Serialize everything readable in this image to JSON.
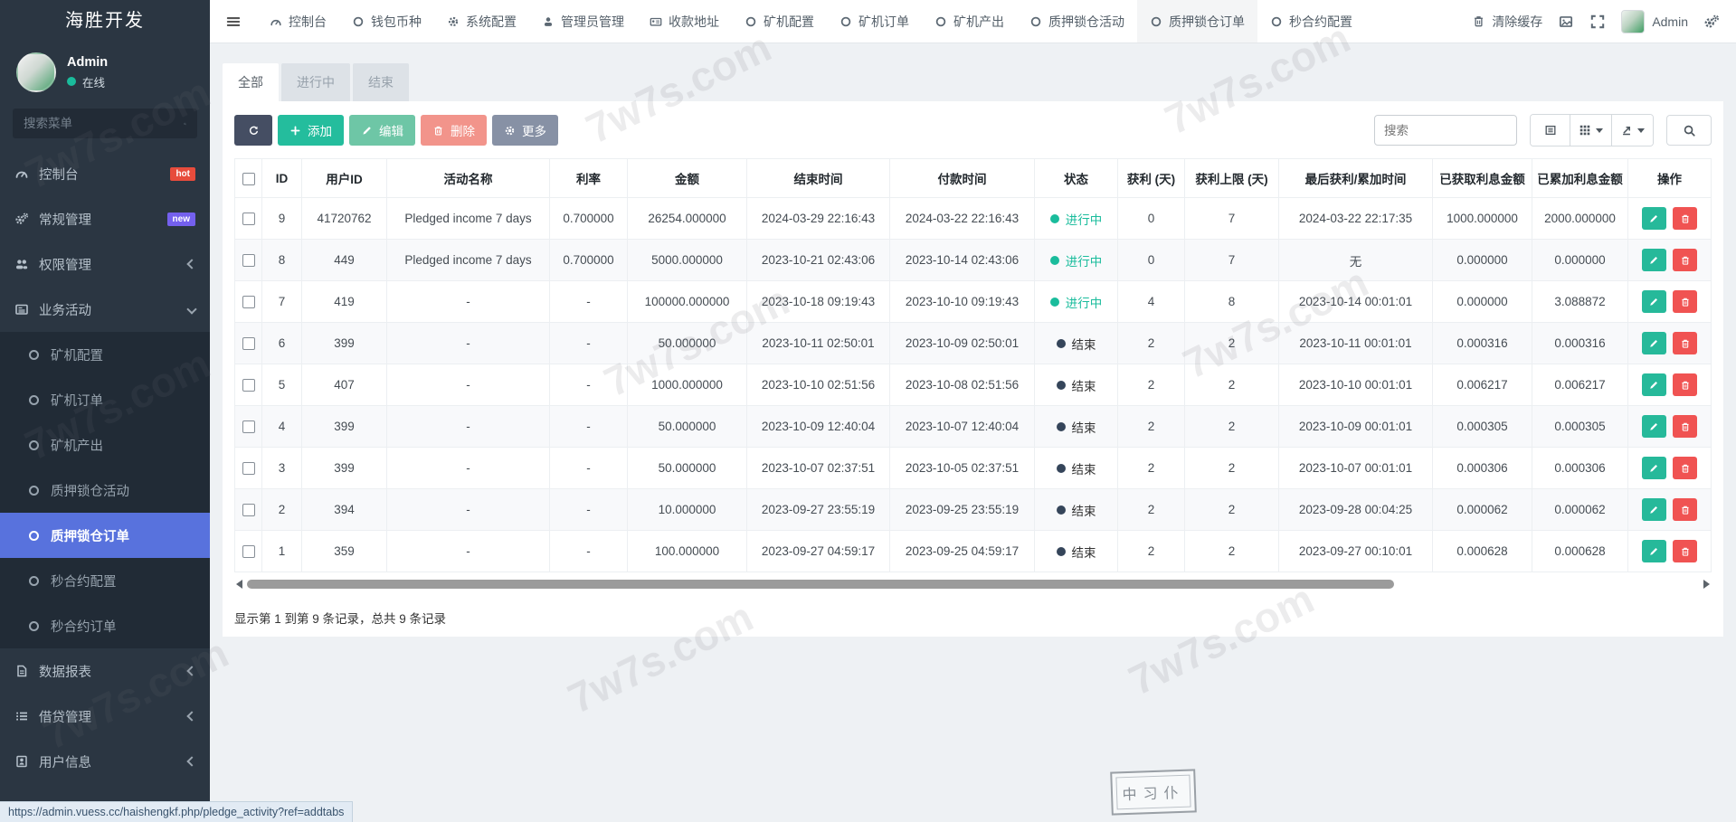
{
  "brand": "海胜开发",
  "user": {
    "name": "Admin",
    "status_label": "在线"
  },
  "sidebar": {
    "search_placeholder": "搜索菜单",
    "items": {
      "console": {
        "label": "控制台",
        "badge": "hot"
      },
      "general": {
        "label": "常规管理",
        "badge": "new"
      },
      "permission": {
        "label": "权限管理"
      },
      "business": {
        "label": "业务活动"
      },
      "report": {
        "label": "数据报表"
      },
      "loan": {
        "label": "借贷管理"
      },
      "userinfo": {
        "label": "用户信息"
      }
    },
    "submenu": [
      {
        "label": "矿机配置"
      },
      {
        "label": "矿机订单"
      },
      {
        "label": "矿机产出"
      },
      {
        "label": "质押锁仓活动"
      },
      {
        "label": "质押锁仓订单",
        "active": true
      },
      {
        "label": "秒合约配置"
      },
      {
        "label": "秒合约订单"
      }
    ]
  },
  "topbar": {
    "tabs": [
      {
        "label": "控制台",
        "icon": "i-gauge"
      },
      {
        "label": "钱包币种",
        "icon": "i-circle"
      },
      {
        "label": "系统配置",
        "icon": "i-gear"
      },
      {
        "label": "管理员管理",
        "icon": "i-user"
      },
      {
        "label": "收款地址",
        "icon": "i-idcard"
      },
      {
        "label": "矿机配置",
        "icon": "i-circle"
      },
      {
        "label": "矿机订单",
        "icon": "i-circle"
      },
      {
        "label": "矿机产出",
        "icon": "i-circle"
      },
      {
        "label": "质押锁仓活动",
        "icon": "i-circle"
      },
      {
        "label": "质押锁仓订单",
        "icon": "i-circle",
        "active": true
      },
      {
        "label": "秒合约配置",
        "icon": "i-circle"
      }
    ],
    "clear_cache_label": "清除缓存",
    "admin_label": "Admin"
  },
  "filter_tabs": [
    {
      "label": "全部",
      "active": true
    },
    {
      "label": "进行中"
    },
    {
      "label": "结束"
    }
  ],
  "toolbar": {
    "add_label": "添加",
    "edit_label": "编辑",
    "delete_label": "删除",
    "more_label": "更多",
    "search_placeholder": "搜索"
  },
  "table": {
    "headers": [
      {
        "label": "ID"
      },
      {
        "label": "用户ID"
      },
      {
        "label": "活动名称"
      },
      {
        "label": "利率"
      },
      {
        "label": "金额"
      },
      {
        "label": "结束时间"
      },
      {
        "label": "付款时间"
      },
      {
        "label": "状态"
      },
      {
        "label": "获利 (天)"
      },
      {
        "label": "获利上限 (天)"
      },
      {
        "label": "最后获利/累加时间"
      },
      {
        "label": "已获取利息金额"
      },
      {
        "label": "已累加利息金额"
      },
      {
        "label": "操作"
      }
    ],
    "rows": [
      {
        "cls": "running",
        "id": "9",
        "user_id": "41720762",
        "activity": "Pledged income 7 days",
        "rate": "0.700000",
        "amount": "26254.000000",
        "end_time": "2024-03-29 22:16:43",
        "pay_time": "2024-03-22 22:16:43",
        "status": "进行中",
        "days": "0",
        "limit": "7",
        "last_time": "2024-03-22 22:17:35",
        "earned": "1000.000000",
        "accrued": "2000.000000"
      },
      {
        "cls": "running",
        "id": "8",
        "user_id": "449",
        "activity": "Pledged income 7 days",
        "rate": "0.700000",
        "amount": "5000.000000",
        "end_time": "2023-10-21 02:43:06",
        "pay_time": "2023-10-14 02:43:06",
        "status": "进行中",
        "days": "0",
        "limit": "7",
        "last_time": "无",
        "earned": "0.000000",
        "accrued": "0.000000"
      },
      {
        "cls": "running",
        "id": "7",
        "user_id": "419",
        "activity": "-",
        "rate": "-",
        "amount": "100000.000000",
        "end_time": "2023-10-18 09:19:43",
        "pay_time": "2023-10-10 09:19:43",
        "status": "进行中",
        "days": "4",
        "limit": "8",
        "last_time": "2023-10-14 00:01:01",
        "earned": "0.000000",
        "accrued": "3.088872"
      },
      {
        "cls": "ended",
        "id": "6",
        "user_id": "399",
        "activity": "-",
        "rate": "-",
        "amount": "50.000000",
        "end_time": "2023-10-11 02:50:01",
        "pay_time": "2023-10-09 02:50:01",
        "status": "结束",
        "days": "2",
        "limit": "2",
        "last_time": "2023-10-11 00:01:01",
        "earned": "0.000316",
        "accrued": "0.000316"
      },
      {
        "cls": "ended",
        "id": "5",
        "user_id": "407",
        "activity": "-",
        "rate": "-",
        "amount": "1000.000000",
        "end_time": "2023-10-10 02:51:56",
        "pay_time": "2023-10-08 02:51:56",
        "status": "结束",
        "days": "2",
        "limit": "2",
        "last_time": "2023-10-10 00:01:01",
        "earned": "0.006217",
        "accrued": "0.006217"
      },
      {
        "cls": "ended",
        "id": "4",
        "user_id": "399",
        "activity": "-",
        "rate": "-",
        "amount": "50.000000",
        "end_time": "2023-10-09 12:40:04",
        "pay_time": "2023-10-07 12:40:04",
        "status": "结束",
        "days": "2",
        "limit": "2",
        "last_time": "2023-10-09 00:01:01",
        "earned": "0.000305",
        "accrued": "0.000305"
      },
      {
        "cls": "ended",
        "id": "3",
        "user_id": "399",
        "activity": "-",
        "rate": "-",
        "amount": "50.000000",
        "end_time": "2023-10-07 02:37:51",
        "pay_time": "2023-10-05 02:37:51",
        "status": "结束",
        "days": "2",
        "limit": "2",
        "last_time": "2023-10-07 00:01:01",
        "earned": "0.000306",
        "accrued": "0.000306"
      },
      {
        "cls": "ended",
        "id": "2",
        "user_id": "394",
        "activity": "-",
        "rate": "-",
        "amount": "10.000000",
        "end_time": "2023-09-27 23:55:19",
        "pay_time": "2023-09-25 23:55:19",
        "status": "结束",
        "days": "2",
        "limit": "2",
        "last_time": "2023-09-28 00:04:25",
        "earned": "0.000062",
        "accrued": "0.000062"
      },
      {
        "cls": "ended",
        "id": "1",
        "user_id": "359",
        "activity": "-",
        "rate": "-",
        "amount": "100.000000",
        "end_time": "2023-09-27 04:59:17",
        "pay_time": "2023-09-25 04:59:17",
        "status": "结束",
        "days": "2",
        "limit": "2",
        "last_time": "2023-09-27 00:10:01",
        "earned": "0.000628",
        "accrued": "0.000628"
      }
    ]
  },
  "records_text": "显示第 1 到第 9 条记录，总共 9 条记录",
  "statusbar_url": "https://admin.vuess.cc/haishengkf.php/pledge_activity?ref=addtabs",
  "watermark_text": "7w7s.com",
  "stamp_text": "中习仆",
  "colors": {
    "accent_blue": "#5872dd",
    "running_teal": "#1abc9c",
    "edit_green": "#26b99a",
    "delete_red": "#f05352",
    "badge_hot": "#e74c3c",
    "badge_new": "#7460ee"
  }
}
